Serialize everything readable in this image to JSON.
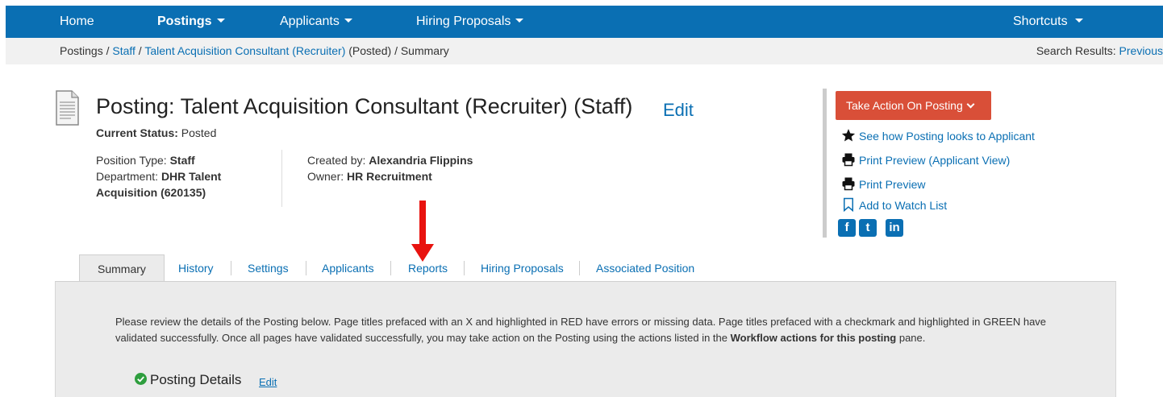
{
  "nav": {
    "home": "Home",
    "postings": "Postings",
    "applicants": "Applicants",
    "hiring_proposals": "Hiring Proposals",
    "shortcuts": "Shortcuts",
    "color": "#0a6fb3"
  },
  "breadcrumb": {
    "postings": "Postings",
    "sep1": " / ",
    "staff": "Staff",
    "sep2": " / ",
    "posting": "Talent Acquisition Consultant (Recruiter)",
    "posted": " (Posted) ",
    "sep3": " / ",
    "summary": "Summary",
    "search_results_label": "Search Results: ",
    "previous": "Previous"
  },
  "header": {
    "icon": "document-icon",
    "title": "Posting: Talent Acquisition Consultant (Recruiter) (Staff)",
    "edit": "Edit",
    "status_label": "Current Status:",
    "status_value": " Posted"
  },
  "meta": {
    "position_type_label": "Position Type: ",
    "position_type_value": "Staff",
    "department_label": "Department: ",
    "department_value": "DHR Talent",
    "department_value_2": "Acquisition (620135)",
    "created_by_label": "Created by: ",
    "created_by_value": "Alexandria Flippins",
    "owner_label": "Owner: ",
    "owner_value": "HR Recruitment"
  },
  "actions": {
    "take_action": "Take Action On Posting",
    "take_action_color": "#d94f38",
    "links": [
      {
        "label": "See how Posting looks to Applicant",
        "icon": "star-icon"
      },
      {
        "label": "Print Preview (Applicant View)",
        "icon": "printer-icon"
      },
      {
        "label": "Print Preview",
        "icon": "printer-icon"
      },
      {
        "label": "Add to Watch List",
        "icon": "bookmark-icon"
      }
    ],
    "social": [
      {
        "glyph": "f",
        "icon": "facebook-icon"
      },
      {
        "glyph": "t",
        "icon": "twitter-icon"
      },
      {
        "glyph": "in",
        "icon": "linkedin-icon"
      }
    ]
  },
  "tabs": [
    {
      "label": "Summary",
      "active": true
    },
    {
      "label": "History"
    },
    {
      "label": "Settings"
    },
    {
      "label": "Applicants"
    },
    {
      "label": "Reports"
    },
    {
      "label": "Hiring Proposals"
    },
    {
      "label": "Associated Position"
    }
  ],
  "content": {
    "instructions_1": "Please review the details of the Posting below.  Page titles prefaced with an X and highlighted in RED have errors or missing data.  Page titles prefaced with a checkmark and highlighted in GREEN have validated successfully.  Once all pages have validated successfully, you may take action on the Posting using the actions listed in the ",
    "instructions_bold": "Workflow actions for this posting",
    "instructions_2": " pane.",
    "section_title": "Posting Details",
    "section_edit": "Edit",
    "section_icon": "check-circle-icon",
    "success_color": "#2e9e3e"
  },
  "annotation": {
    "icon": "red-arrow-icon",
    "color": "#e8130f"
  }
}
